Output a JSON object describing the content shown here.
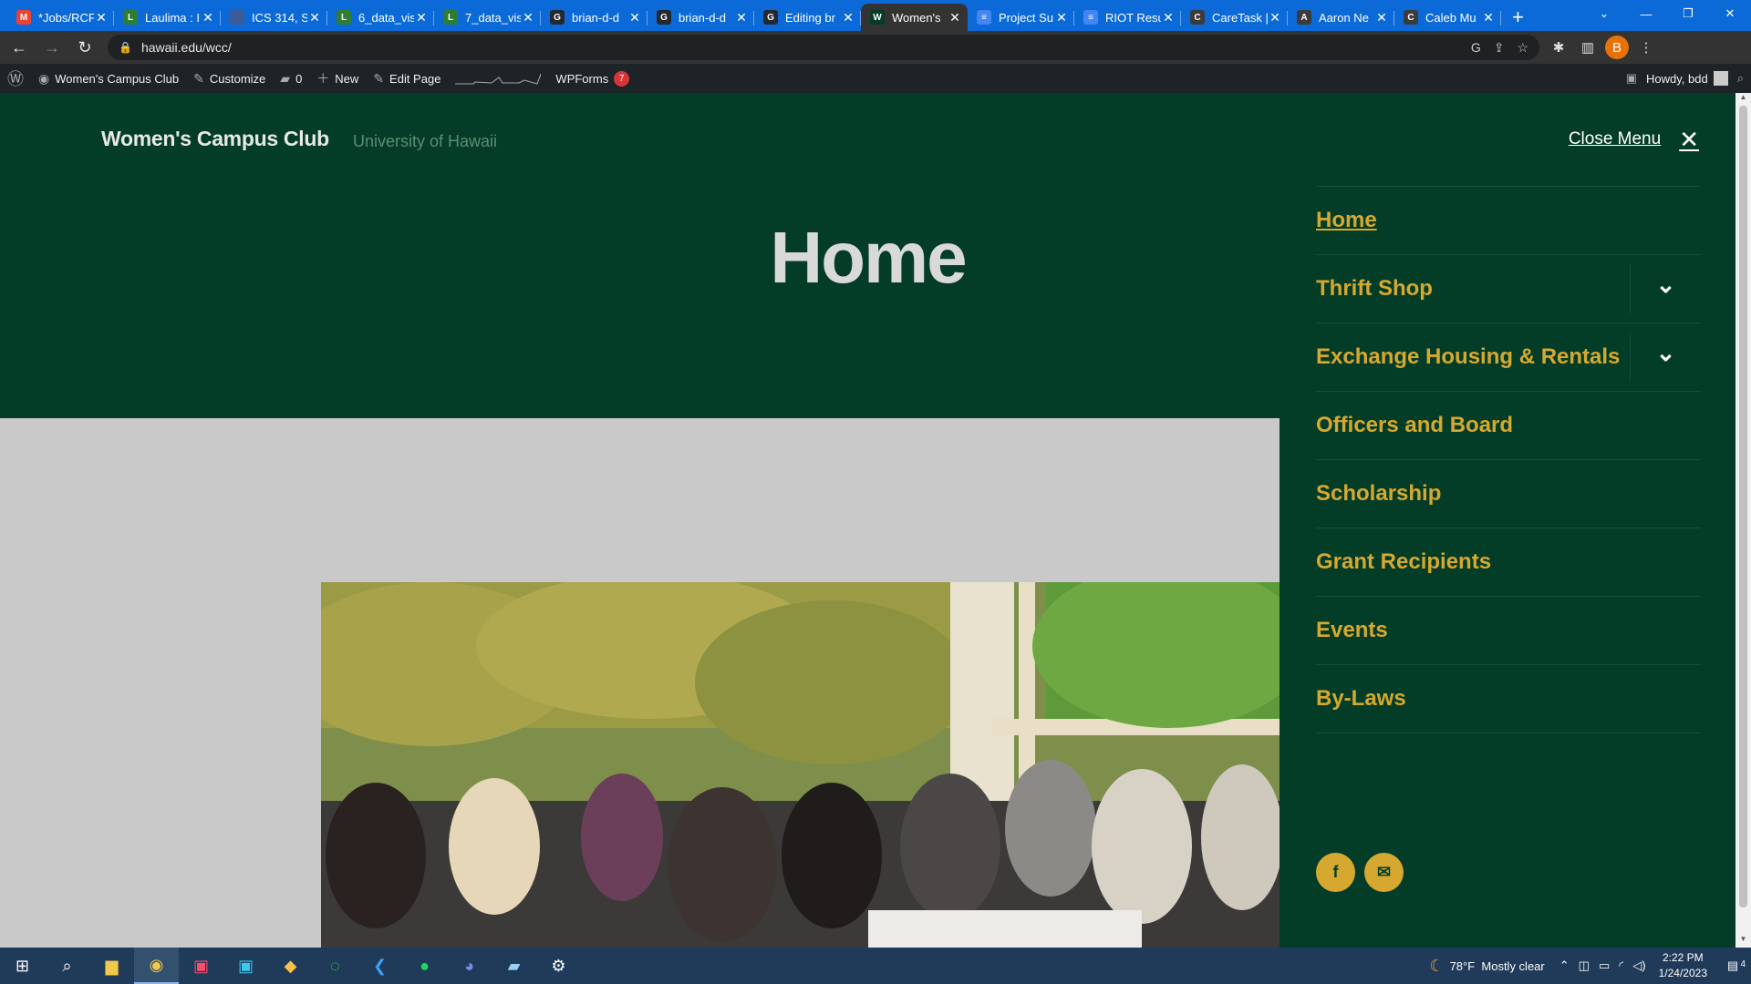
{
  "browser": {
    "tabs": [
      {
        "title": "*Jobs/RCF",
        "fav_color": "#ea4335",
        "glyph": "M"
      },
      {
        "title": "Laulima : I",
        "fav_color": "#2e7d32",
        "glyph": "L"
      },
      {
        "title": "ICS 314, S",
        "fav_color": "#3d5a99",
        "glyph": ""
      },
      {
        "title": "6_data_vis",
        "fav_color": "#2e7d32",
        "glyph": "L"
      },
      {
        "title": "7_data_vis",
        "fav_color": "#2e7d32",
        "glyph": "L"
      },
      {
        "title": "brian-d-d",
        "fav_color": "#24292f",
        "glyph": "G"
      },
      {
        "title": "brian-d-d",
        "fav_color": "#24292f",
        "glyph": "G"
      },
      {
        "title": "Editing br",
        "fav_color": "#24292f",
        "glyph": "G"
      },
      {
        "title": "Women's",
        "fav_color": "#033d27",
        "glyph": "W"
      },
      {
        "title": "Project Su",
        "fav_color": "#4285f4",
        "glyph": "≡"
      },
      {
        "title": "RIOT Resu",
        "fav_color": "#4285f4",
        "glyph": "≡"
      },
      {
        "title": "CareTask |",
        "fav_color": "#3b3b3b",
        "glyph": "C"
      },
      {
        "title": "Aaron Ne",
        "fav_color": "#3b3b3b",
        "glyph": "A"
      },
      {
        "title": "Caleb Mu",
        "fav_color": "#3b3b3b",
        "glyph": "C"
      }
    ],
    "active_tab": 8,
    "url": "hawaii.edu/wcc/",
    "profile_initial": "B"
  },
  "adminbar": {
    "site_name": "Women's Campus Club",
    "customize": "Customize",
    "comments_count": "0",
    "new_label": "New",
    "edit_page": "Edit Page",
    "wpforms": "WPForms",
    "wpforms_count": "7",
    "howdy": "Howdy, bdd"
  },
  "site": {
    "title": "Women's Campus Club",
    "description": "University of Hawaii",
    "page_title": "Home"
  },
  "menu": {
    "close_label": "Close Menu",
    "items": [
      {
        "label": "Home",
        "current": true,
        "has_children": false
      },
      {
        "label": "Thrift Shop",
        "current": false,
        "has_children": true
      },
      {
        "label": "Exchange Housing & Rentals",
        "current": false,
        "has_children": true
      },
      {
        "label": "Officers and Board",
        "current": false,
        "has_children": false
      },
      {
        "label": "Scholarship",
        "current": false,
        "has_children": false
      },
      {
        "label": "Grant Recipients",
        "current": false,
        "has_children": false
      },
      {
        "label": "Events",
        "current": false,
        "has_children": false
      },
      {
        "label": "By-Laws",
        "current": false,
        "has_children": false
      }
    ],
    "social": [
      {
        "name": "facebook-icon",
        "glyph": "f"
      },
      {
        "name": "email-icon",
        "glyph": "✉"
      }
    ]
  },
  "colors": {
    "hero_bg": "#033d27",
    "accent_gold": "#d7a82f"
  },
  "taskbar": {
    "weather": "78°F  Mostly clear",
    "time": "2:22 PM",
    "date": "1/24/2023",
    "notifications": "4"
  }
}
